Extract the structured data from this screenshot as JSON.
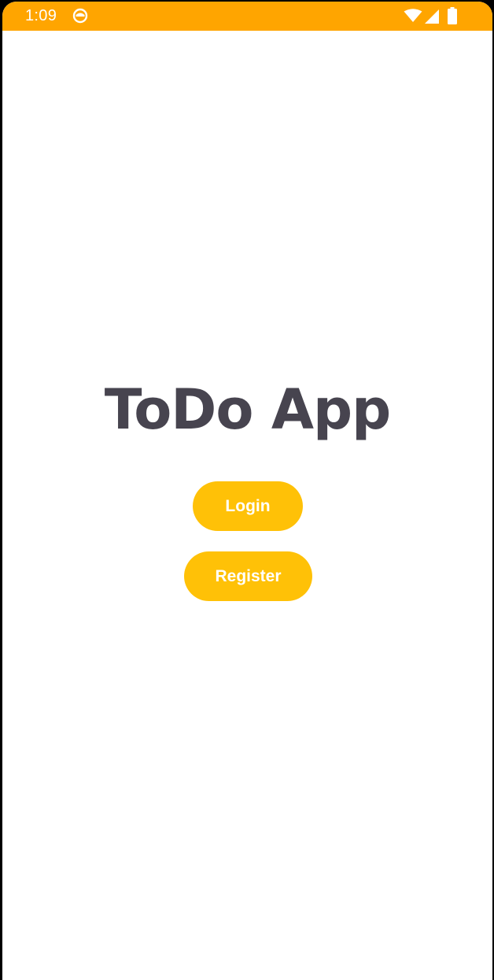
{
  "status_bar": {
    "time": "1:09",
    "background_color": "#FFA500",
    "icons": [
      "app-notification-icon",
      "wifi-icon",
      "cellular-signal-icon",
      "battery-icon"
    ]
  },
  "main": {
    "title": "ToDo App",
    "title_color": "#47444F",
    "login_label": "Login",
    "register_label": "Register",
    "button_color": "#FFC107",
    "button_text_color": "#FFFFFF"
  }
}
